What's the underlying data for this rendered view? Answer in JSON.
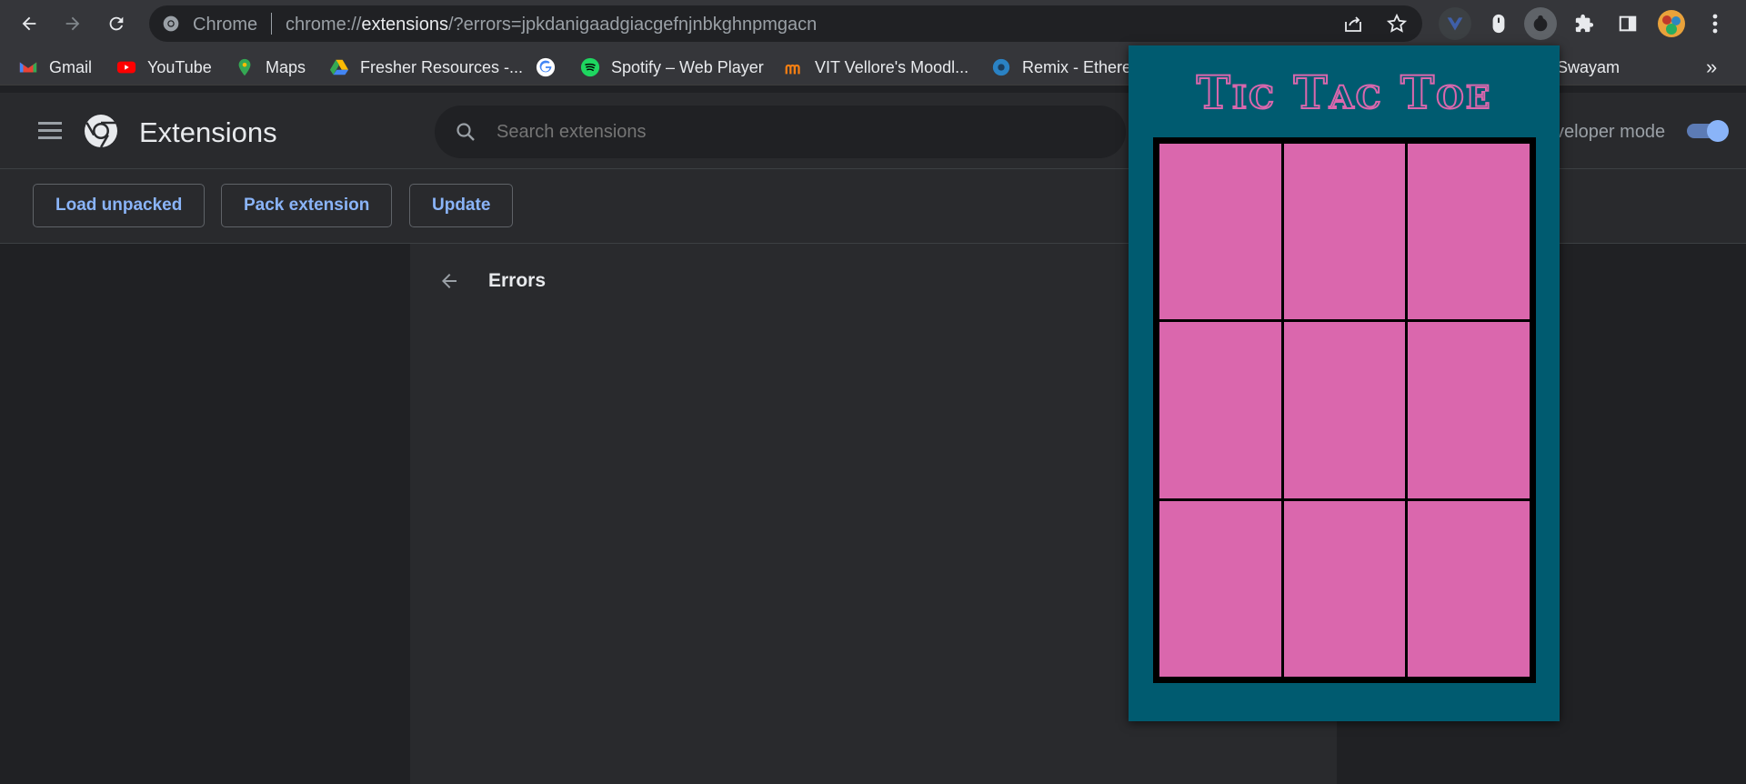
{
  "browser": {
    "site_label": "Chrome",
    "url_scheme": "chrome://",
    "url_host": "extensions",
    "url_rest": "/?errors=jpkdanigaadgiacgefnjnbkghnpmgacn"
  },
  "bookmarks": [
    {
      "label": "Gmail",
      "icon": "gmail-icon"
    },
    {
      "label": "YouTube",
      "icon": "youtube-icon"
    },
    {
      "label": "Maps",
      "icon": "maps-icon"
    },
    {
      "label": "Fresher Resources -...",
      "icon": "drive-icon"
    },
    {
      "label": "",
      "icon": "google-icon"
    },
    {
      "label": "Spotify – Web Player",
      "icon": "spotify-icon"
    },
    {
      "label": "VIT Vellore's Moodl...",
      "icon": "moodle-icon"
    },
    {
      "label": "Remix - Ethere",
      "icon": "remix-icon"
    },
    {
      "label": "Swayam",
      "icon": "swayam-icon"
    }
  ],
  "header": {
    "title": "Extensions",
    "search_placeholder": "Search extensions",
    "dev_mode_label": "veloper mode",
    "dev_mode_on": true
  },
  "toolbar": {
    "load_unpacked": "Load unpacked",
    "pack_extension": "Pack extension",
    "update": "Update"
  },
  "main": {
    "errors_title": "Errors"
  },
  "popup": {
    "title": "Tic Tac Toe",
    "cells": [
      "",
      "",
      "",
      "",
      "",
      "",
      "",
      "",
      ""
    ],
    "colors": {
      "background": "#005b70",
      "cell": "#da67ad",
      "grid": "#000000"
    }
  }
}
